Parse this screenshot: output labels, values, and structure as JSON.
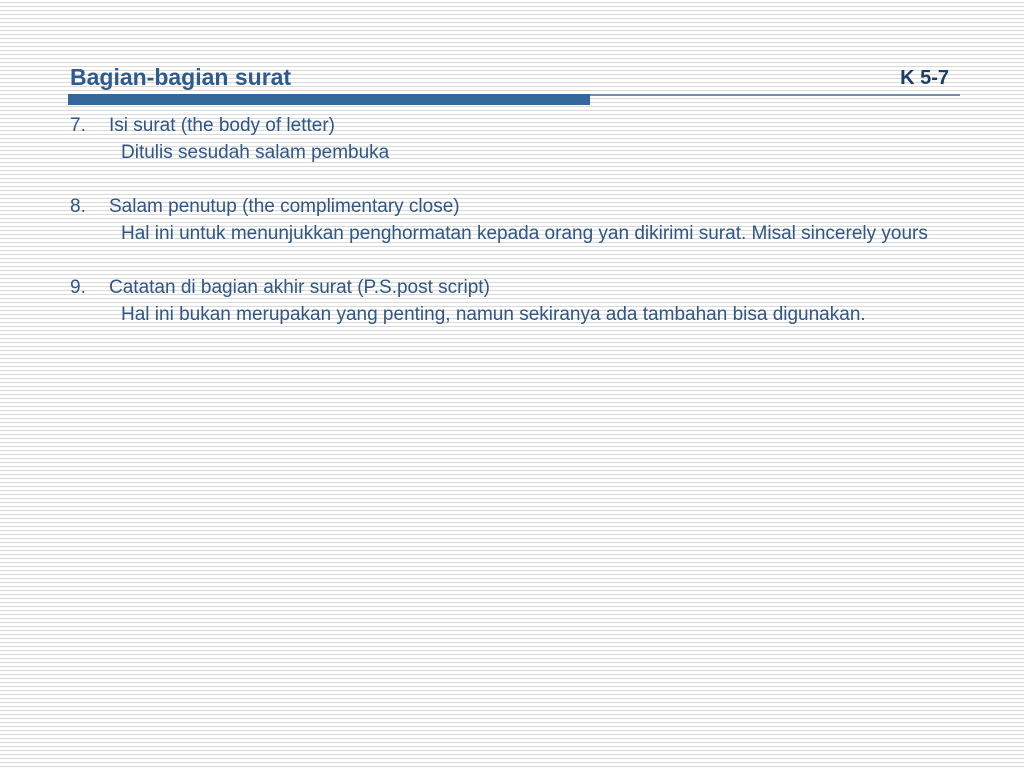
{
  "slide": {
    "title": "Bagian-bagian surat",
    "code": "K 5-7",
    "accent_color": "#336699"
  },
  "items": [
    {
      "number": "7.",
      "heading": "Isi surat (the body of letter)",
      "description": "Ditulis sesudah salam pembuka"
    },
    {
      "number": "8.",
      "heading": "Salam penutup (the complimentary close)",
      "description": "Hal ini untuk menunjukkan penghormatan kepada orang yan dikirimi surat. Misal sincerely yours"
    },
    {
      "number": "9.",
      "heading": "Catatan di bagian akhir surat (P.S.post script)",
      "description": "Hal ini bukan merupakan yang penting, namun sekiranya ada tambahan bisa digunakan."
    }
  ]
}
